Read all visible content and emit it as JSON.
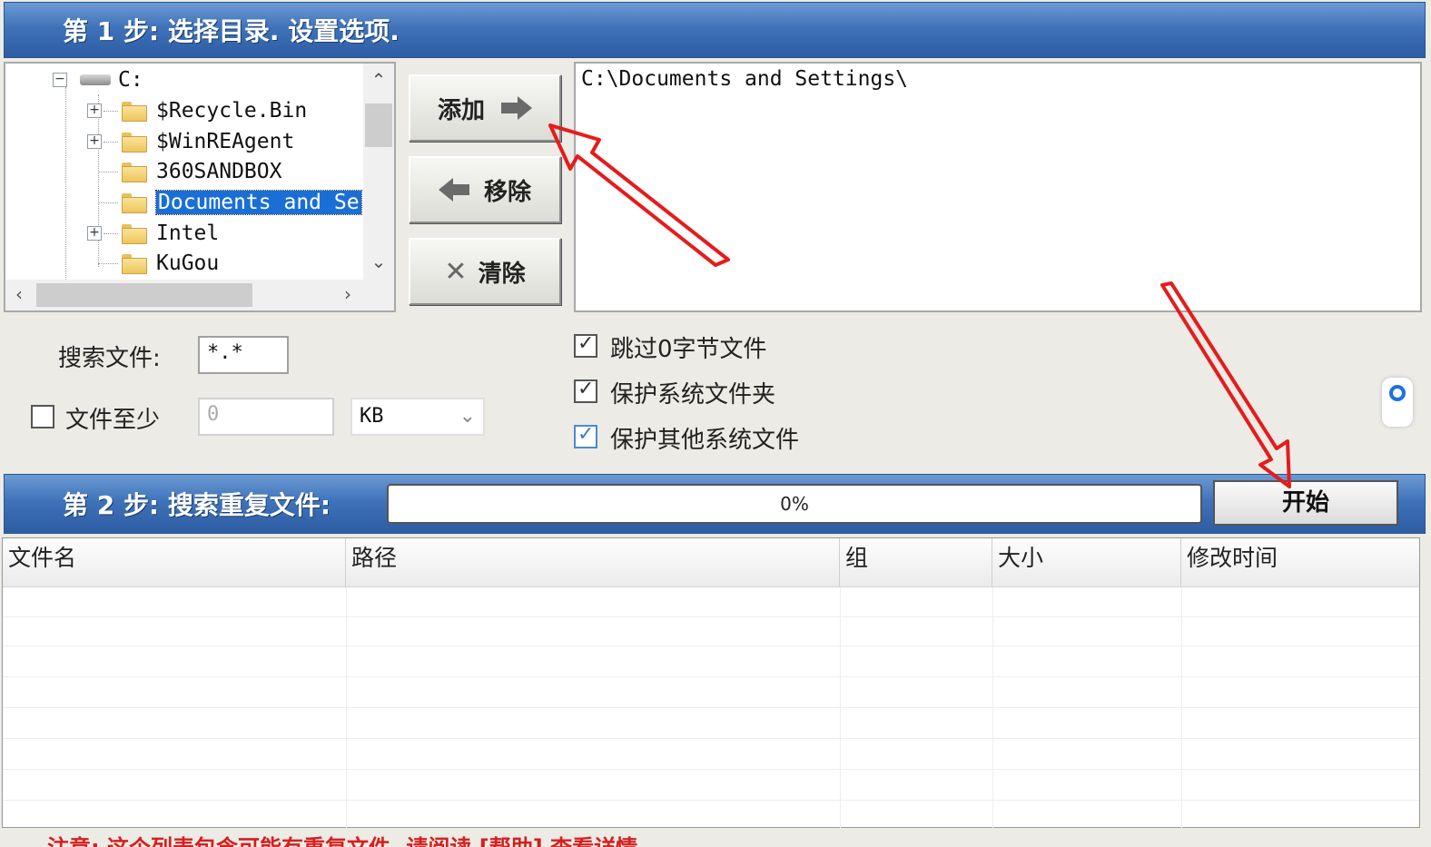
{
  "step1": {
    "title": "第 1 步: 选择目录. 设置选项."
  },
  "tree": {
    "drive": "C:",
    "items": [
      {
        "label": "$Recycle.Bin",
        "expandable": true,
        "selected": false
      },
      {
        "label": "$WinREAgent",
        "expandable": true,
        "selected": false
      },
      {
        "label": "360SANDBOX",
        "expandable": false,
        "selected": false
      },
      {
        "label": "Documents and Se",
        "expandable": false,
        "selected": true
      },
      {
        "label": "Intel",
        "expandable": true,
        "selected": false
      },
      {
        "label": "KuGou",
        "expandable": false,
        "selected": false
      }
    ]
  },
  "buttons": {
    "add": "添加",
    "remove": "移除",
    "clear": "清除",
    "start": "开始"
  },
  "paths": [
    "C:\\Documents and Settings\\"
  ],
  "options": {
    "search_label": "搜索文件:",
    "search_pattern": "*.*",
    "min_size_label": "文件至少",
    "min_size_checked": false,
    "min_size_value": "0",
    "unit": "KB",
    "skip_zero": "跳过0字节文件",
    "skip_zero_checked": true,
    "protect_sys_folder": "保护系统文件夹",
    "protect_sys_folder_checked": true,
    "protect_other_sys": "保护其他系统文件",
    "protect_other_sys_checked": true
  },
  "step2": {
    "title": "第 2 步: 搜索重复文件:",
    "progress": "0%"
  },
  "table": {
    "columns": [
      "文件名",
      "路径",
      "组",
      "大小",
      "修改时间"
    ]
  },
  "note": "注意: 这个列表包含可能有重复文件, 请阅读 [帮助] 查看详情",
  "colors": {
    "banner": "#3f73b9",
    "selection": "#1a6fd6",
    "annotation": "#e51c1c"
  }
}
